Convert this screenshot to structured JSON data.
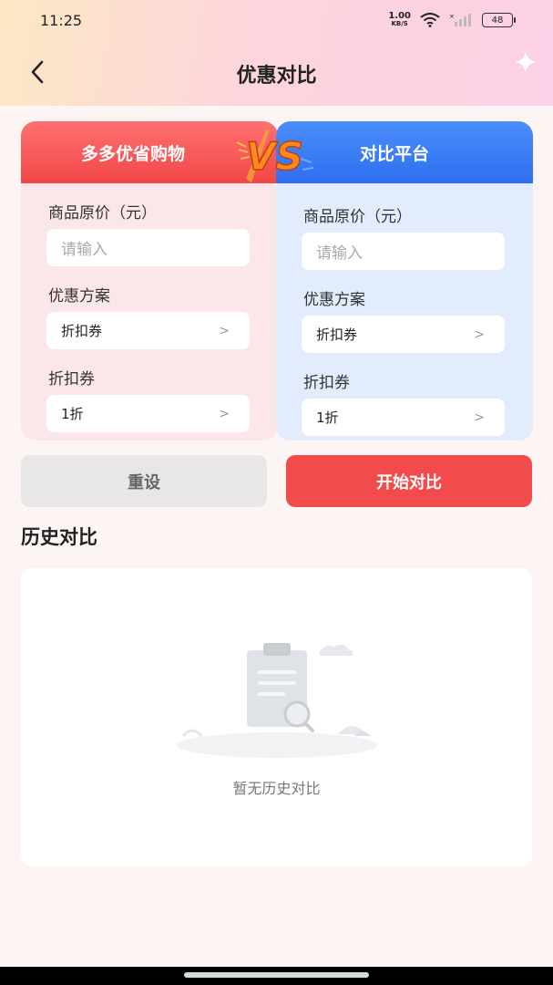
{
  "status_bar": {
    "time": "11:25",
    "net_speed_value": "1.00",
    "net_speed_unit": "KB/S",
    "battery": "48"
  },
  "nav": {
    "title": "优惠对比"
  },
  "left_panel": {
    "title": "多多优省购物",
    "price_label": "商品原价（元）",
    "price_placeholder": "请输入",
    "plan_label": "优惠方案",
    "plan_value": "折扣券",
    "coupon_label": "折扣券",
    "coupon_value": "1折"
  },
  "right_panel": {
    "title": "对比平台",
    "price_label": "商品原价（元）",
    "price_placeholder": "请输入",
    "plan_label": "优惠方案",
    "plan_value": "折扣券",
    "coupon_label": "折扣券",
    "coupon_value": "1折"
  },
  "vs_label": "VS",
  "actions": {
    "reset": "重设",
    "start": "开始对比"
  },
  "history": {
    "title": "历史对比",
    "empty_text": "暂无历史对比"
  },
  "colors": {
    "accent_red": "#f24b4b",
    "accent_blue": "#2e6ff0"
  }
}
